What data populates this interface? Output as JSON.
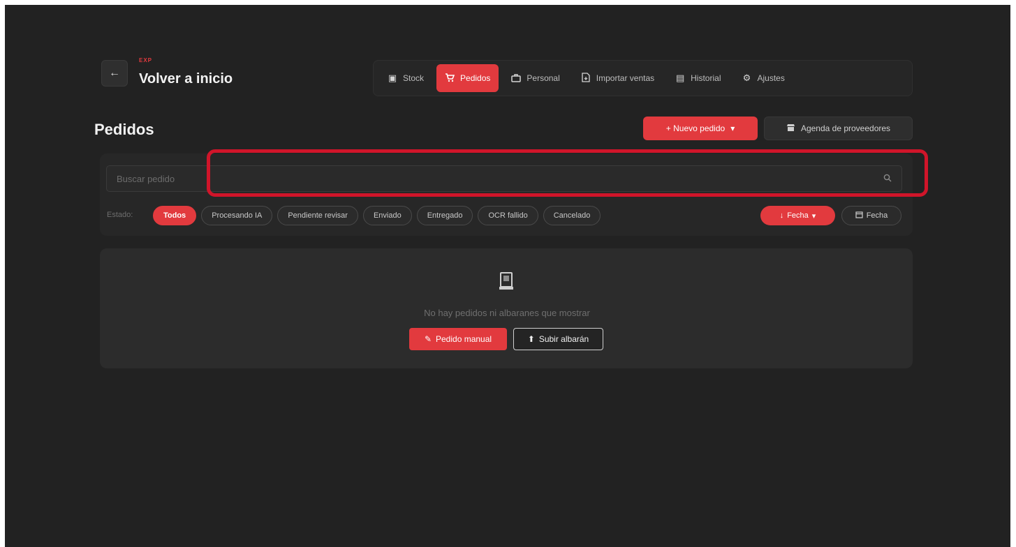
{
  "header": {
    "back_icon": "arrow-left-icon",
    "brand_tag": "EXP",
    "back_label": "Volver a inicio"
  },
  "nav": {
    "items": [
      {
        "label": "Stock",
        "icon": "box-icon",
        "glyph": "▣",
        "active": false
      },
      {
        "label": "Pedidos",
        "icon": "cart-icon",
        "glyph": "🛒",
        "active": true
      },
      {
        "label": "Personal",
        "icon": "staff-icon",
        "glyph": "♜",
        "active": false
      },
      {
        "label": "Importar ventas",
        "icon": "file-import-icon",
        "glyph": "🗋",
        "active": false
      },
      {
        "label": "Historial",
        "icon": "history-icon",
        "glyph": "▤",
        "active": false
      },
      {
        "label": "Ajustes",
        "icon": "gear-icon",
        "glyph": "⚙",
        "active": false
      }
    ]
  },
  "page": {
    "title": "Pedidos",
    "new_order_label": "+ Nuevo pedido",
    "new_order_caret": "▾",
    "agenda_label": "Agenda de proveedores"
  },
  "search": {
    "placeholder": "Buscar pedido",
    "value": ""
  },
  "filters": {
    "status_label": "Estado:",
    "chips": [
      {
        "label": "Todos",
        "active": true
      },
      {
        "label": "Procesando IA",
        "active": false
      },
      {
        "label": "Pendiente revisar",
        "active": false
      },
      {
        "label": "Enviado",
        "active": false
      },
      {
        "label": "Entregado",
        "active": false
      },
      {
        "label": "OCR fallido",
        "active": false
      },
      {
        "label": "Cancelado",
        "active": false
      }
    ],
    "sort_label": "Fecha",
    "date_label": "Fecha"
  },
  "empty_state": {
    "icon": "document-icon",
    "message": "No hay pedidos ni albaranes que mostrar",
    "manual_label": "Pedido manual",
    "upload_label": "Subir albarán"
  },
  "colors": {
    "accent": "#e23a3e",
    "background": "#222222",
    "highlight": "#d0152a"
  }
}
